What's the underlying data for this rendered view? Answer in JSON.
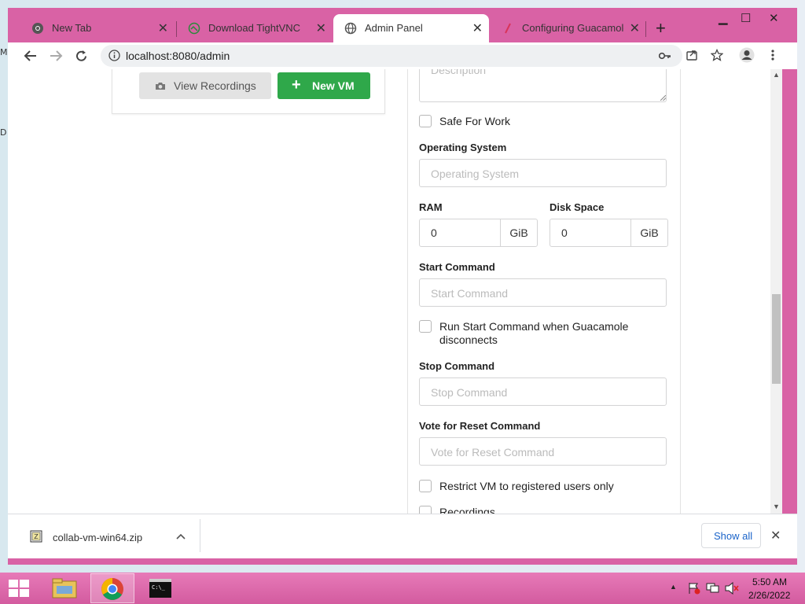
{
  "desktop": {
    "letters": [
      "M",
      "D"
    ]
  },
  "tabs": [
    {
      "title": "New Tab",
      "icon": "chrome-icon",
      "active": false
    },
    {
      "title": "Download TightVNC",
      "icon": "tightvnc-icon",
      "active": false
    },
    {
      "title": "Admin Panel",
      "icon": "globe-icon",
      "active": true
    },
    {
      "title": "Configuring Guacamole -",
      "icon": "guacamole-icon",
      "active": false
    }
  ],
  "toolbar": {
    "url": "localhost:8080/admin"
  },
  "left_panel": {
    "view_recordings": "View Recordings",
    "new_vm": "New VM"
  },
  "form": {
    "description_placeholder": "Description",
    "safe_for_work": "Safe For Work",
    "os_label": "Operating System",
    "os_placeholder": "Operating System",
    "ram_label": "RAM",
    "ram_value": "0",
    "ram_unit": "GiB",
    "disk_label": "Disk Space",
    "disk_value": "0",
    "disk_unit": "GiB",
    "start_label": "Start Command",
    "start_placeholder": "Start Command",
    "run_start_line1": "Run Start Command when Guacamole",
    "run_start_line2": "disconnects",
    "stop_label": "Stop Command",
    "stop_placeholder": "Stop Command",
    "vote_label": "Vote for Reset Command",
    "vote_placeholder": "Vote for Reset Command",
    "restrict_label": "Restrict VM to registered users only",
    "recordings_label": "Recordings"
  },
  "downloads": {
    "filename": "collab-vm-win64.zip",
    "show_all": "Show all"
  },
  "taskbar": {
    "time": "5:50 AM",
    "date": "2/26/2022"
  },
  "colors": {
    "window_frame": "#d962a5",
    "new_vm_button": "#2fa84a",
    "taskbar": "#d35b9f"
  }
}
